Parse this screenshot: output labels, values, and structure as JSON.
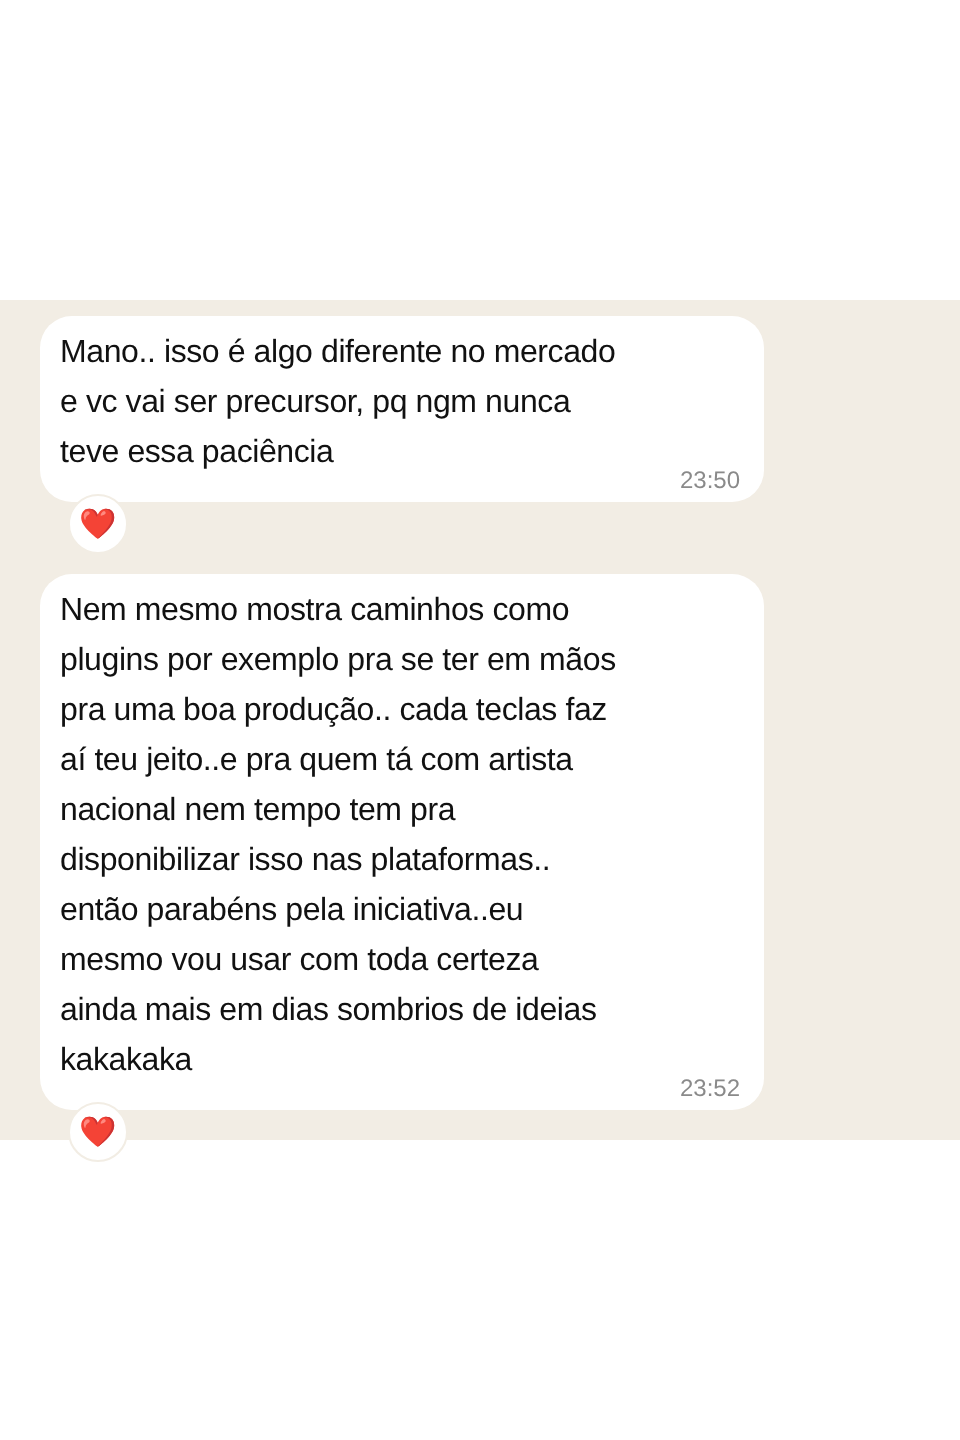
{
  "messages": [
    {
      "text": "Mano.. isso é algo diferente no mercado\ne vc vai ser precursor, pq ngm nunca\nteve essa paciência",
      "time": "23:50",
      "reaction": "❤️"
    },
    {
      "text": "Nem mesmo mostra caminhos como\nplugins por exemplo pra se ter em mãos\npra uma boa produção.. cada teclas faz\naí teu jeito..e pra quem tá com artista\nnacional nem tempo tem pra\ndisponibilizar isso nas plataformas..\nentão parabéns pela iniciativa..eu\nmesmo vou usar com toda certeza\nainda mais em dias sombrios de ideias\nkakakaka",
      "time": "23:52",
      "reaction": "❤️"
    }
  ]
}
